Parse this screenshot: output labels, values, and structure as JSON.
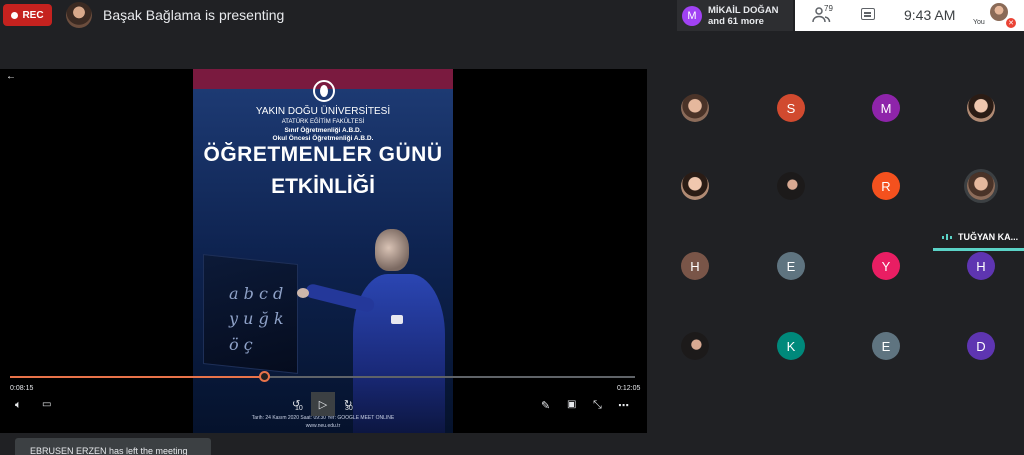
{
  "top_bar": {
    "rec_label": "REC",
    "presenter_text": "Başak Bağlama is presenting",
    "pinned": {
      "initial": "M",
      "name": "MİKAİL DOĞAN",
      "more": "and 61 more"
    },
    "people_count": "79",
    "time": "9:43  AM",
    "you_label": "You"
  },
  "presentation": {
    "poster": {
      "university": "YAKIN DOĞU ÜNİVERSİTESİ",
      "faculty": "ATATÜRK EĞİTİM FAKÜLTESİ",
      "department1": "Sınıf Öğretmenliği A.B.D.",
      "department2": "Okul Öncesi Öğretmenliği A.B.D.",
      "title_line1": "ÖĞRETMENLER GÜNÜ",
      "title_line2": "ETKİNLİĞİ",
      "chalk1": "a b c d",
      "chalk2": "y u ğ k",
      "chalk3": "ö ç",
      "footer1": "Tarih: 24 Kasım 2020  Saat: 09:30  Yer: GOOGLE MEET ONLINE",
      "footer2": "www.neu.edu.tr"
    },
    "player": {
      "current_time": "0:08:15",
      "total_time": "0:12:05",
      "progress": 0.408,
      "skip_back": "10",
      "skip_forward": "30"
    }
  },
  "participants": [
    {
      "initial": "",
      "color": "photo"
    },
    {
      "initial": "S",
      "color": "#d14a2f"
    },
    {
      "initial": "M",
      "color": "#8e24aa"
    },
    {
      "initial": "",
      "color": "photo2"
    },
    {
      "initial": "",
      "color": "photo2"
    },
    {
      "initial": "",
      "color": "photo3"
    },
    {
      "initial": "R",
      "color": "#f4511e"
    },
    {
      "initial": "",
      "color": "photo"
    },
    {
      "initial": "H",
      "color": "#795548"
    },
    {
      "initial": "E",
      "color": "#5f7480"
    },
    {
      "initial": "Y",
      "color": "#e91e63"
    },
    {
      "initial": "H",
      "color": "#5e35b1"
    },
    {
      "initial": "",
      "color": "photo3"
    },
    {
      "initial": "K",
      "color": "#00897b"
    },
    {
      "initial": "E",
      "color": "#5f7480"
    },
    {
      "initial": "D",
      "color": "#5e35b1"
    }
  ],
  "speaker_name": "TUĞYAN KA...",
  "toast": {
    "text": "EBRUSEN ERZEN has left the meeting"
  }
}
